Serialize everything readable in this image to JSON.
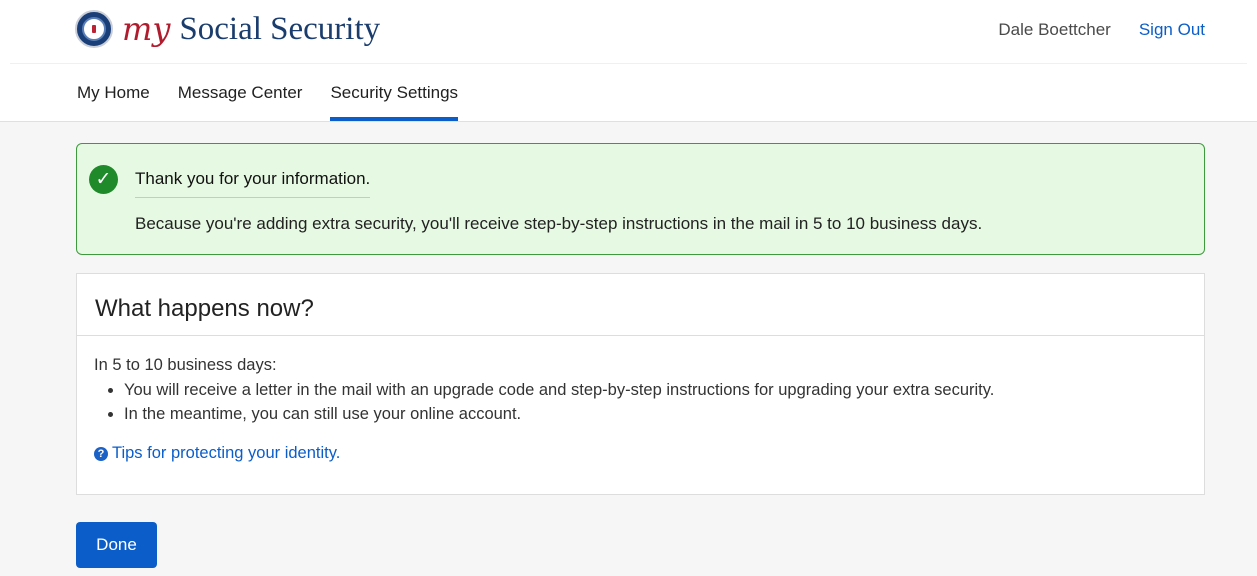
{
  "header": {
    "brand_my": "my",
    "brand_rest": "Social Security",
    "user_name": "Dale Boettcher",
    "sign_out": "Sign Out"
  },
  "nav": {
    "items": [
      {
        "label": "My Home"
      },
      {
        "label": "Message Center"
      },
      {
        "label": "Security Settings",
        "active": true
      }
    ]
  },
  "alert": {
    "icon": "check-circle-icon",
    "title": "Thank you for your information.",
    "body": "Because you're adding extra security, you'll receive step-by-step instructions in the mail in 5 to 10 business days."
  },
  "card": {
    "heading": "What happens now?",
    "intro": "In 5 to 10 business days:",
    "bullets": [
      "You will receive a letter in the mail with an upgrade code and step-by-step instructions for upgrading your extra security.",
      "In the meantime, you can still use your online account."
    ],
    "tips_link": "Tips for protecting your identity."
  },
  "actions": {
    "done_label": "Done"
  },
  "colors": {
    "primary": "#0b5ec9",
    "success_bg": "#e6f9e2",
    "success_border": "#3d9b3d",
    "brand_red": "#b01c2e",
    "brand_navy": "#1b3d6d"
  }
}
